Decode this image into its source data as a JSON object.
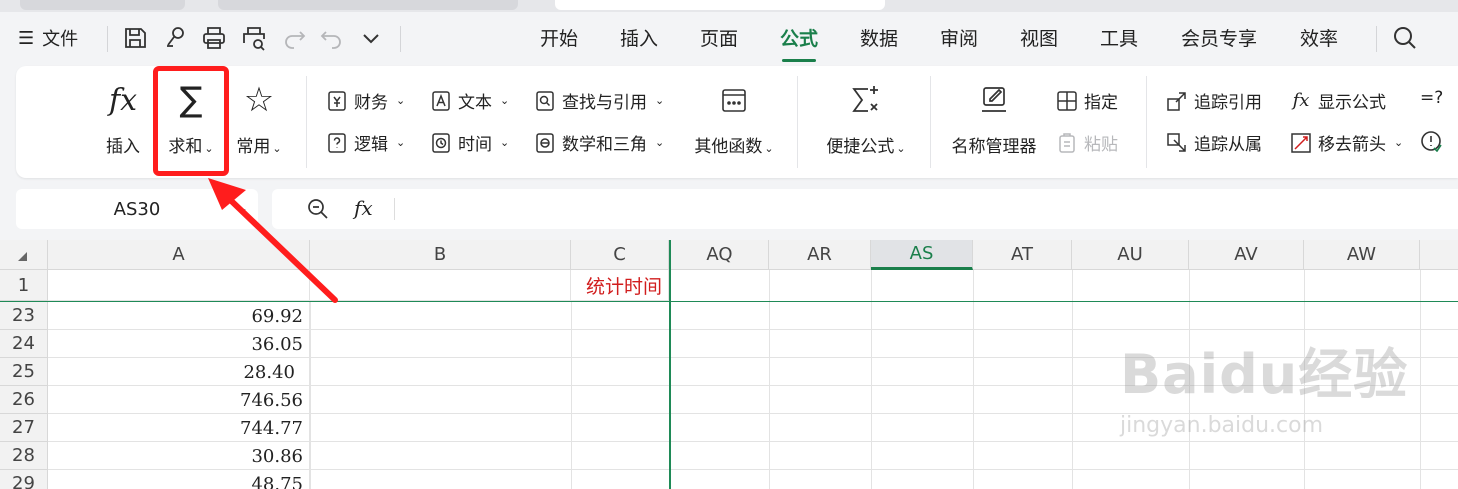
{
  "menu": {
    "file_label": "文件",
    "tabs": [
      "开始",
      "插入",
      "页面",
      "公式",
      "数据",
      "审阅",
      "视图",
      "工具",
      "会员专享",
      "效率"
    ],
    "active_tab": "公式"
  },
  "ribbon": {
    "insert_fn": {
      "icon": "fx",
      "label": "插入"
    },
    "sum": {
      "icon": "∑",
      "label": "求和"
    },
    "common": {
      "icon": "☆",
      "label": "常用"
    },
    "cats": {
      "finance": "财务",
      "text": "文本",
      "lookup": "查找与引用",
      "logic": "逻辑",
      "time": "时间",
      "math": "数学和三角",
      "other": "其他函数"
    },
    "quick_formula": "便捷公式",
    "name_manager": "名称管理器",
    "define": "指定",
    "paste": "粘贴",
    "trace_precedents": "追踪引用",
    "trace_dependents": "追踪从属",
    "show_formulas": "显示公式",
    "remove_arrows": "移去箭头",
    "eq_question": "=?"
  },
  "formula_bar": {
    "name_box": "AS30",
    "fx": "fx"
  },
  "columns": [
    "A",
    "B",
    "C",
    "AQ",
    "AR",
    "AS",
    "AT",
    "AU",
    "AV",
    "AW"
  ],
  "selected_column": "AS",
  "rows": [
    {
      "num": "1",
      "a": "",
      "c": "统计时间"
    },
    {
      "num": "23",
      "a": "69.92"
    },
    {
      "num": "24",
      "a": "36.05"
    },
    {
      "num": "25",
      "a": "28.40"
    },
    {
      "num": "26",
      "a": "746.56"
    },
    {
      "num": "27",
      "a": "744.77"
    },
    {
      "num": "28",
      "a": "30.86"
    },
    {
      "num": "29",
      "a": "48.75"
    }
  ],
  "watermark": {
    "brand": "Baidu经验",
    "url": "jingyan.baidu.com"
  },
  "colors": {
    "accent": "#1a7f4b",
    "annotation": "#ff1d1d",
    "header_text_red": "#d11d1d"
  }
}
